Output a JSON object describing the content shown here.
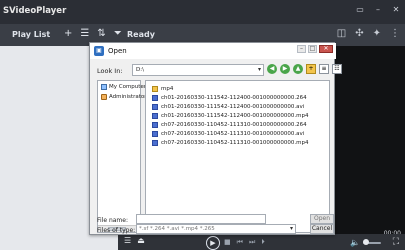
{
  "app": {
    "title": "SVideoPlayer"
  },
  "window_controls": {
    "minimize": "▭",
    "restore": "–",
    "close": "✕"
  },
  "toolbar": {
    "playlist_label": "Play List",
    "icons": [
      "plus-icon",
      "list-icon",
      "sort-icon",
      "filter-icon"
    ],
    "status": "Ready",
    "right_icons": [
      "screenshot-icon",
      "crop-icon",
      "pin-icon",
      "more-icon"
    ]
  },
  "player": {
    "time": "00:00"
  },
  "dialog": {
    "title": "Open",
    "look_in_label": "Look In:",
    "look_in_value": "D:\\",
    "places": [
      "My Computer",
      "Administrator"
    ],
    "files": [
      {
        "icon": "folder-icon",
        "name": "mp4"
      },
      {
        "icon": "video-file-icon",
        "name": "ch01-20160330-111542-112400-001000000000.264"
      },
      {
        "icon": "video-file-icon",
        "name": "ch01-20160330-111542-112400-001000000000.avi"
      },
      {
        "icon": "video-file-icon",
        "name": "ch01-20160330-111542-112400-001000000000.mp4"
      },
      {
        "icon": "video-file-icon",
        "name": "ch07-20160330-110452-111310-001000000000.264"
      },
      {
        "icon": "video-file-icon",
        "name": "ch07-20160330-110452-111310-001000000000.avi"
      },
      {
        "icon": "video-file-icon",
        "name": "ch07-20160330-110452-111310-001000000000.mp4"
      }
    ],
    "file_name_label": "File name:",
    "file_name_value": "",
    "open_button": "Open",
    "files_of_type_label": "Files of type:",
    "files_of_type_value": "*.sf *.264 *.avi *.mp4 *.265",
    "cancel_button": "Cancel"
  }
}
